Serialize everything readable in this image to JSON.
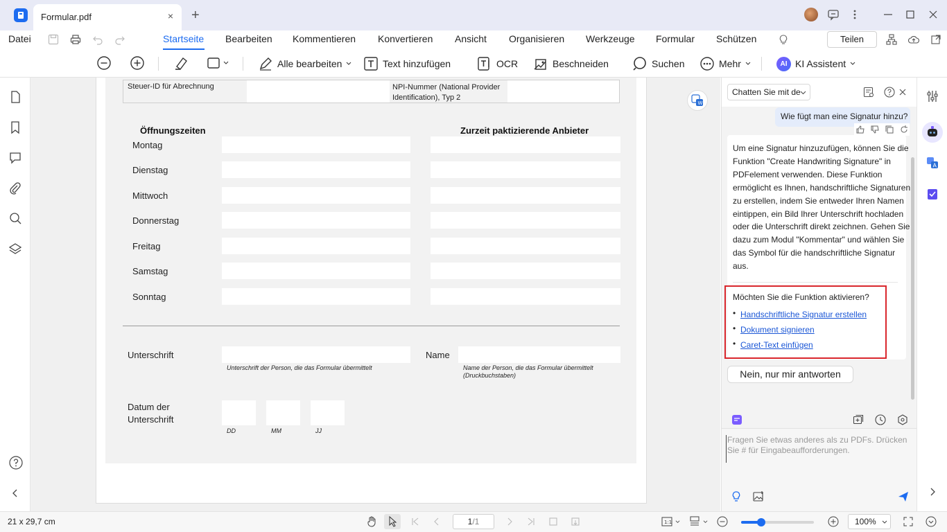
{
  "titlebar": {
    "tab_title": "Formular.pdf",
    "close_glyph": "×",
    "new_tab_glyph": "+"
  },
  "menubar": {
    "file_label": "Datei",
    "tabs": [
      {
        "label": "Startseite",
        "active": true
      },
      {
        "label": "Bearbeiten"
      },
      {
        "label": "Kommentieren"
      },
      {
        "label": "Konvertieren"
      },
      {
        "label": "Ansicht"
      },
      {
        "label": "Organisieren"
      },
      {
        "label": "Werkzeuge"
      },
      {
        "label": "Formular"
      },
      {
        "label": "Schützen"
      }
    ],
    "share_label": "Teilen"
  },
  "toolbar": {
    "edit_all_label": "Alle bearbeiten",
    "add_text_label": "Text hinzufügen",
    "ocr_label": "OCR",
    "crop_label": "Beschneiden",
    "search_label": "Suchen",
    "more_label": "Mehr",
    "ai_label": "KI Assistent",
    "ai_badge": "AI"
  },
  "form": {
    "tax_id_label": "Steuer-ID für Abrechnung",
    "npi_label": "NPI-Nummer (National Provider Identification), Typ 2",
    "opening_hours_header": "Öffnungszeiten",
    "providers_header": "Zurzeit paktizierende Anbieter",
    "days": [
      "Montag",
      "Dienstag",
      "Mittwoch",
      "Donnerstag",
      "Freitag",
      "Samstag",
      "Sonntag"
    ],
    "signature_label": "Unterschrift",
    "signature_hint": "Unterschrift der Person, die das Formular übermittelt",
    "name_label": "Name",
    "name_hint": "Name der Person, die das Formular übermittelt (Druckbuchstaben)",
    "date_label": "Datum der Unterschrift",
    "date_parts": [
      "DD",
      "MM",
      "JJ"
    ]
  },
  "ai_panel": {
    "mode_select": "Chatten Sie mit de",
    "user_message": "Wie fügt man eine Signatur hinzu?",
    "assistant_message": "Um eine Signatur hinzuzufügen, können Sie die Funktion \"Create Handwriting Signature\" in PDFelement verwenden. Diese Funktion ermöglicht es Ihnen, handschriftliche Signaturen zu erstellen, indem Sie entweder Ihren Namen eintippen, ein Bild Ihrer Unterschrift hochladen oder die Unterschrift direkt zeichnen. Gehen Sie dazu zum Modul \"Kommentar\" und wählen Sie das Symbol für die handschriftliche Signatur aus.",
    "question": "Möchten Sie die Funktion aktivieren?",
    "options": [
      "Handschriftliche Signatur erstellen",
      "Dokument signieren",
      "Caret-Text einfügen"
    ],
    "reply_button": "Nein, nur mir antworten",
    "input_placeholder": "Fragen Sie etwas anderes als zu PDFs. Drücken Sie # für Eingabeaufforderungen."
  },
  "statusbar": {
    "page_size": "21 x 29,7 cm",
    "page_current": "1",
    "page_total": "/1",
    "zoom": "100%",
    "zoom_slider_fraction": 0.28
  },
  "colors": {
    "accent": "#1d6cf0",
    "highlight_border": "#d9262c",
    "titlebar_bg": "#e8eaf6"
  }
}
